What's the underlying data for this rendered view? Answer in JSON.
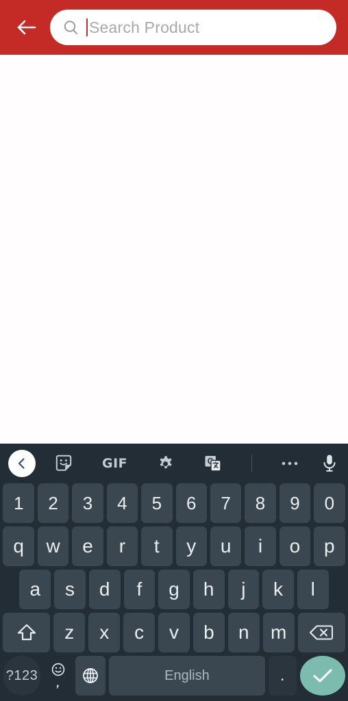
{
  "header": {
    "back_icon": "arrow-left-icon",
    "background_color": "#c52b26",
    "search": {
      "icon": "search-icon",
      "placeholder": "Search Product",
      "value": "",
      "caret_color": "#c52b26"
    }
  },
  "content": {
    "background_color": "#fffdfd",
    "body_text": ""
  },
  "keyboard": {
    "background_color": "#222d35",
    "key_color": "#3b4750",
    "key_text_color": "#e9eef1",
    "accent_color": "#7cbcaf",
    "toolbar": {
      "back_label": "‹",
      "items": [
        {
          "name": "keyboard-back-button",
          "label": ""
        },
        {
          "name": "sticker-icon",
          "label": ""
        },
        {
          "name": "gif-button",
          "label": "GIF"
        },
        {
          "name": "settings-gear-icon",
          "label": ""
        },
        {
          "name": "google-translate-icon",
          "label": ""
        },
        {
          "name": "toolbar-divider",
          "label": ""
        },
        {
          "name": "overflow-menu-icon",
          "label": "•••"
        },
        {
          "name": "microphone-icon",
          "label": ""
        }
      ]
    },
    "rows": {
      "numbers": [
        "1",
        "2",
        "3",
        "4",
        "5",
        "6",
        "7",
        "8",
        "9",
        "0"
      ],
      "top": [
        "q",
        "w",
        "e",
        "r",
        "t",
        "y",
        "u",
        "i",
        "o",
        "p"
      ],
      "home": [
        "a",
        "s",
        "d",
        "f",
        "g",
        "h",
        "j",
        "k",
        "l"
      ],
      "bottom": [
        "z",
        "x",
        "c",
        "v",
        "b",
        "n",
        "m"
      ]
    },
    "special_keys": {
      "shift": "shift-key",
      "backspace": "backspace-key",
      "symbols": "?123",
      "emoji": "emoji-key",
      "comma": ",",
      "language_globe": "globe-key",
      "space_label": "English",
      "period": ".",
      "enter": "check-enter-key"
    }
  }
}
